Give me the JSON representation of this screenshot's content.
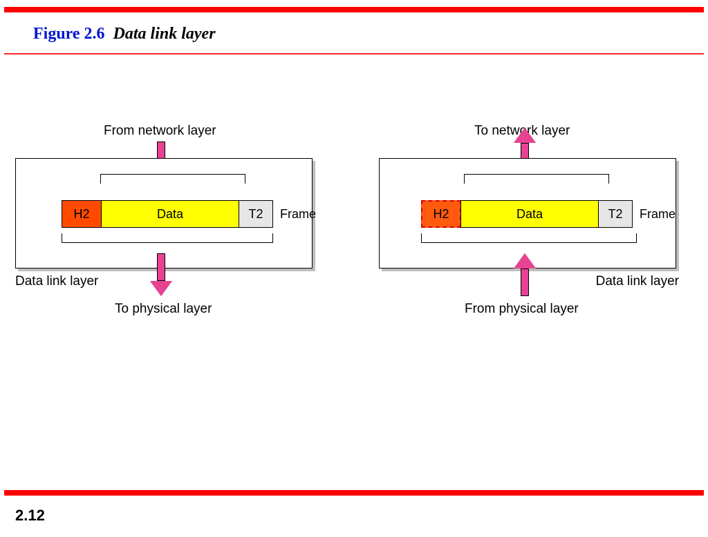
{
  "figure": {
    "number": "Figure 2.6",
    "title": "Data link layer"
  },
  "labels": {
    "from_network": "From network layer",
    "to_network": "To network layer",
    "to_physical": "To physical layer",
    "from_physical": "From physical layer",
    "layer_caption": "Data link layer",
    "frame": "Frame"
  },
  "segments": {
    "header": "H2",
    "payload": "Data",
    "trailer": "T2"
  },
  "page": "2.12",
  "colors": {
    "accent_red": "#ff0000",
    "title_blue": "#0016d0",
    "arrow_pink": "#e84393",
    "header_orange": "#ff4a00",
    "payload_yellow": "#ffff00",
    "trailer_grey": "#e6e6e6"
  }
}
